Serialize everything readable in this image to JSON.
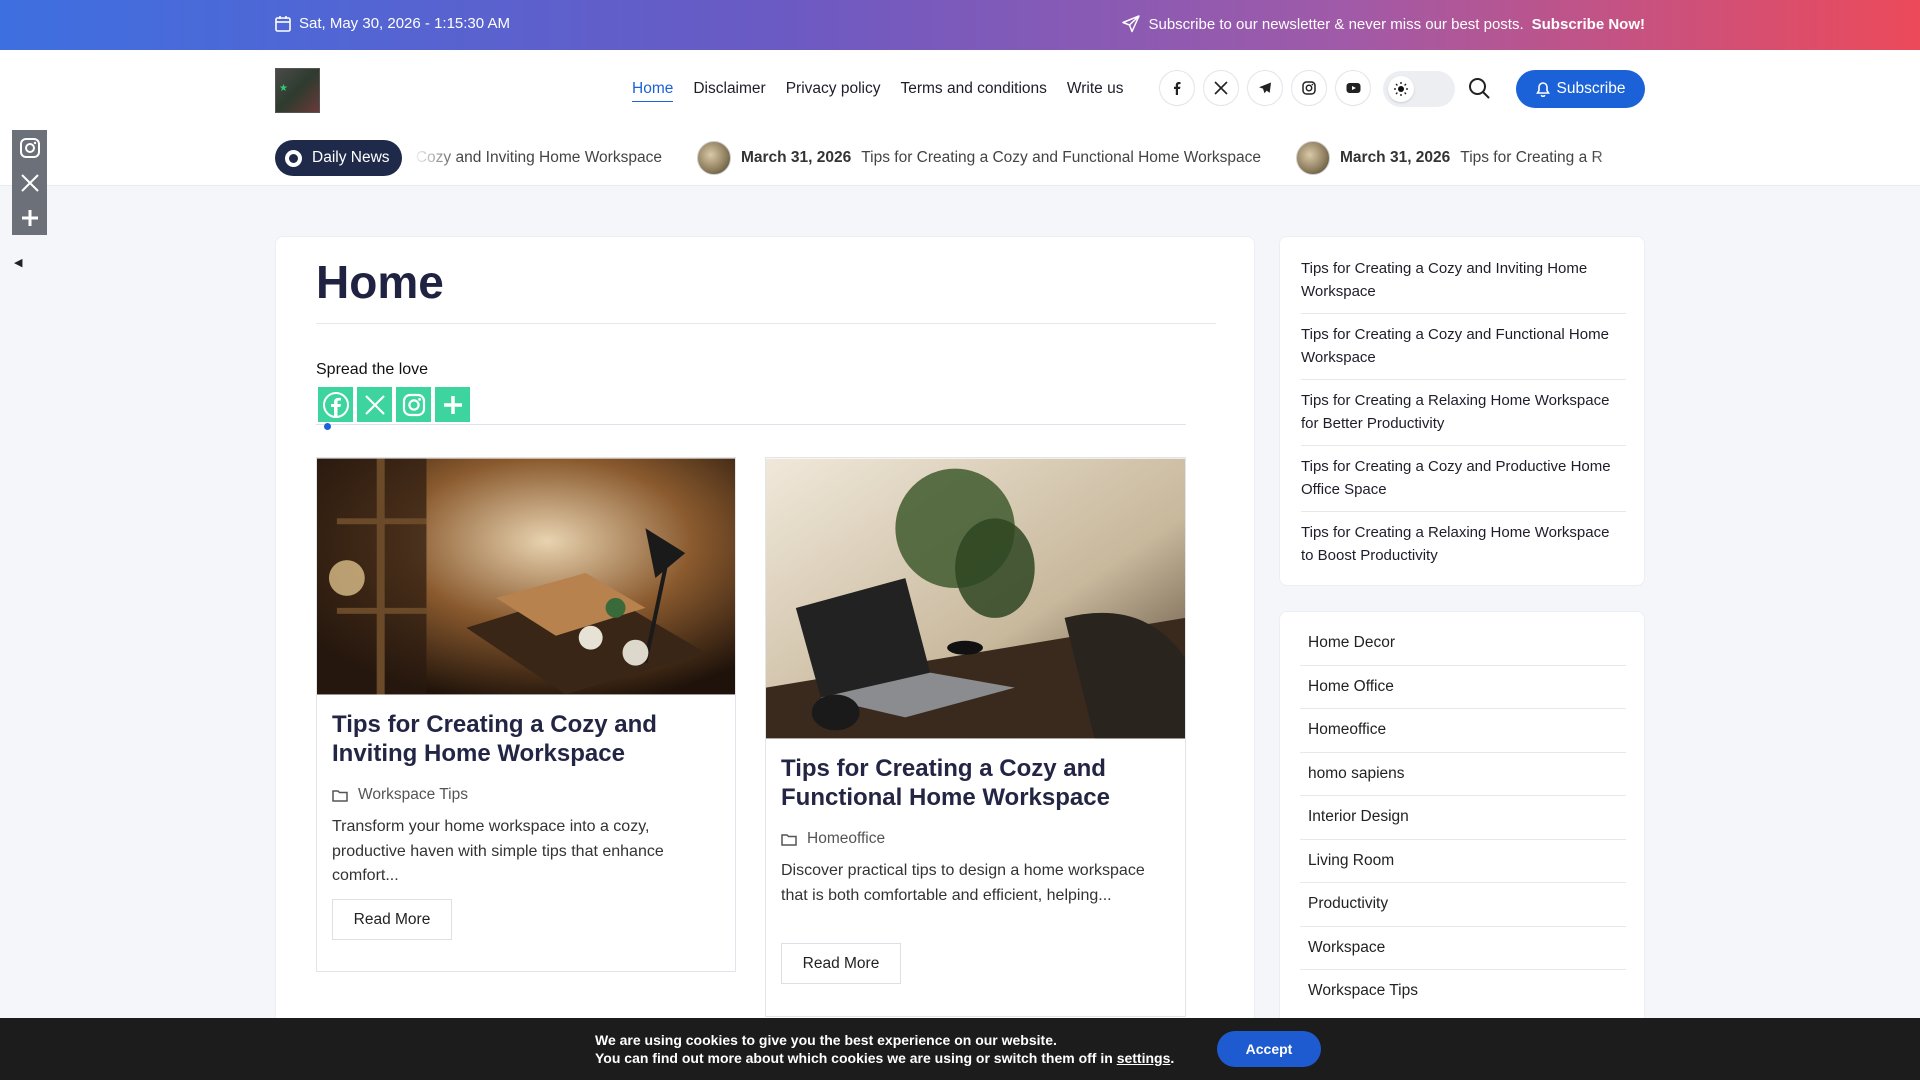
{
  "topbar": {
    "date": "Sat, May 30, 2026 - 1:15:30 AM",
    "newsletter_text": "Subscribe to our newsletter & never miss our best posts.",
    "newsletter_cta": "Subscribe Now!"
  },
  "nav": {
    "items": [
      {
        "label": "Home",
        "active": true
      },
      {
        "label": "Disclaimer"
      },
      {
        "label": "Privacy policy"
      },
      {
        "label": "Terms and conditions"
      },
      {
        "label": "Write us"
      }
    ],
    "socials": [
      "facebook-icon",
      "x-icon",
      "telegram-icon",
      "instagram-icon",
      "youtube-icon"
    ],
    "subscribe_label": "Subscribe"
  },
  "ticker": {
    "label": "Daily News",
    "items": [
      {
        "date": "",
        "title": "g a Cozy and Inviting Home Workspace"
      },
      {
        "date": "March 31, 2026",
        "title": "Tips for Creating a Cozy and Functional Home Workspace"
      },
      {
        "date": "March 31, 2026",
        "title": "Tips for Creating a R"
      }
    ]
  },
  "main": {
    "page_title": "Home",
    "spread_label": "Spread the love",
    "posts": [
      {
        "title": "Tips for Creating a Cozy and Inviting Home Workspace",
        "category": "Workspace Tips",
        "excerpt": "Transform your home workspace into a cozy, productive haven with simple tips that enhance comfort...",
        "read_more": "Read More"
      },
      {
        "title": "Tips for Creating a Cozy and Functional Home Workspace",
        "category": "Homeoffice",
        "excerpt": "Discover practical tips to design a home workspace that is both comfortable and efficient, helping...",
        "read_more": "Read More"
      }
    ]
  },
  "sidebar": {
    "recent_posts": [
      "Tips for Creating a Cozy and Inviting Home Workspace",
      "Tips for Creating a Cozy and Functional Home Workspace",
      "Tips for Creating a Relaxing Home Workspace for Better Productivity",
      "Tips for Creating a Cozy and Productive Home Office Space",
      "Tips for Creating a Relaxing Home Workspace to Boost Productivity"
    ],
    "categories": [
      "Home Decor",
      "Home Office",
      "Homeoffice",
      "homo sapiens",
      "Interior Design",
      "Living Room",
      "Productivity",
      "Workspace",
      "Workspace Tips"
    ]
  },
  "cookie": {
    "line1": "We are using cookies to give you the best experience on our website.",
    "line2_prefix": "You can find out more about which cookies we are using or switch them off in",
    "line2_link": "settings",
    "line2_suffix": ".",
    "accept_label": "Accept"
  },
  "colors": {
    "accent": "#1b62d8",
    "share_green": "#3dd4a0",
    "dark_navy": "#1f2a4a"
  }
}
